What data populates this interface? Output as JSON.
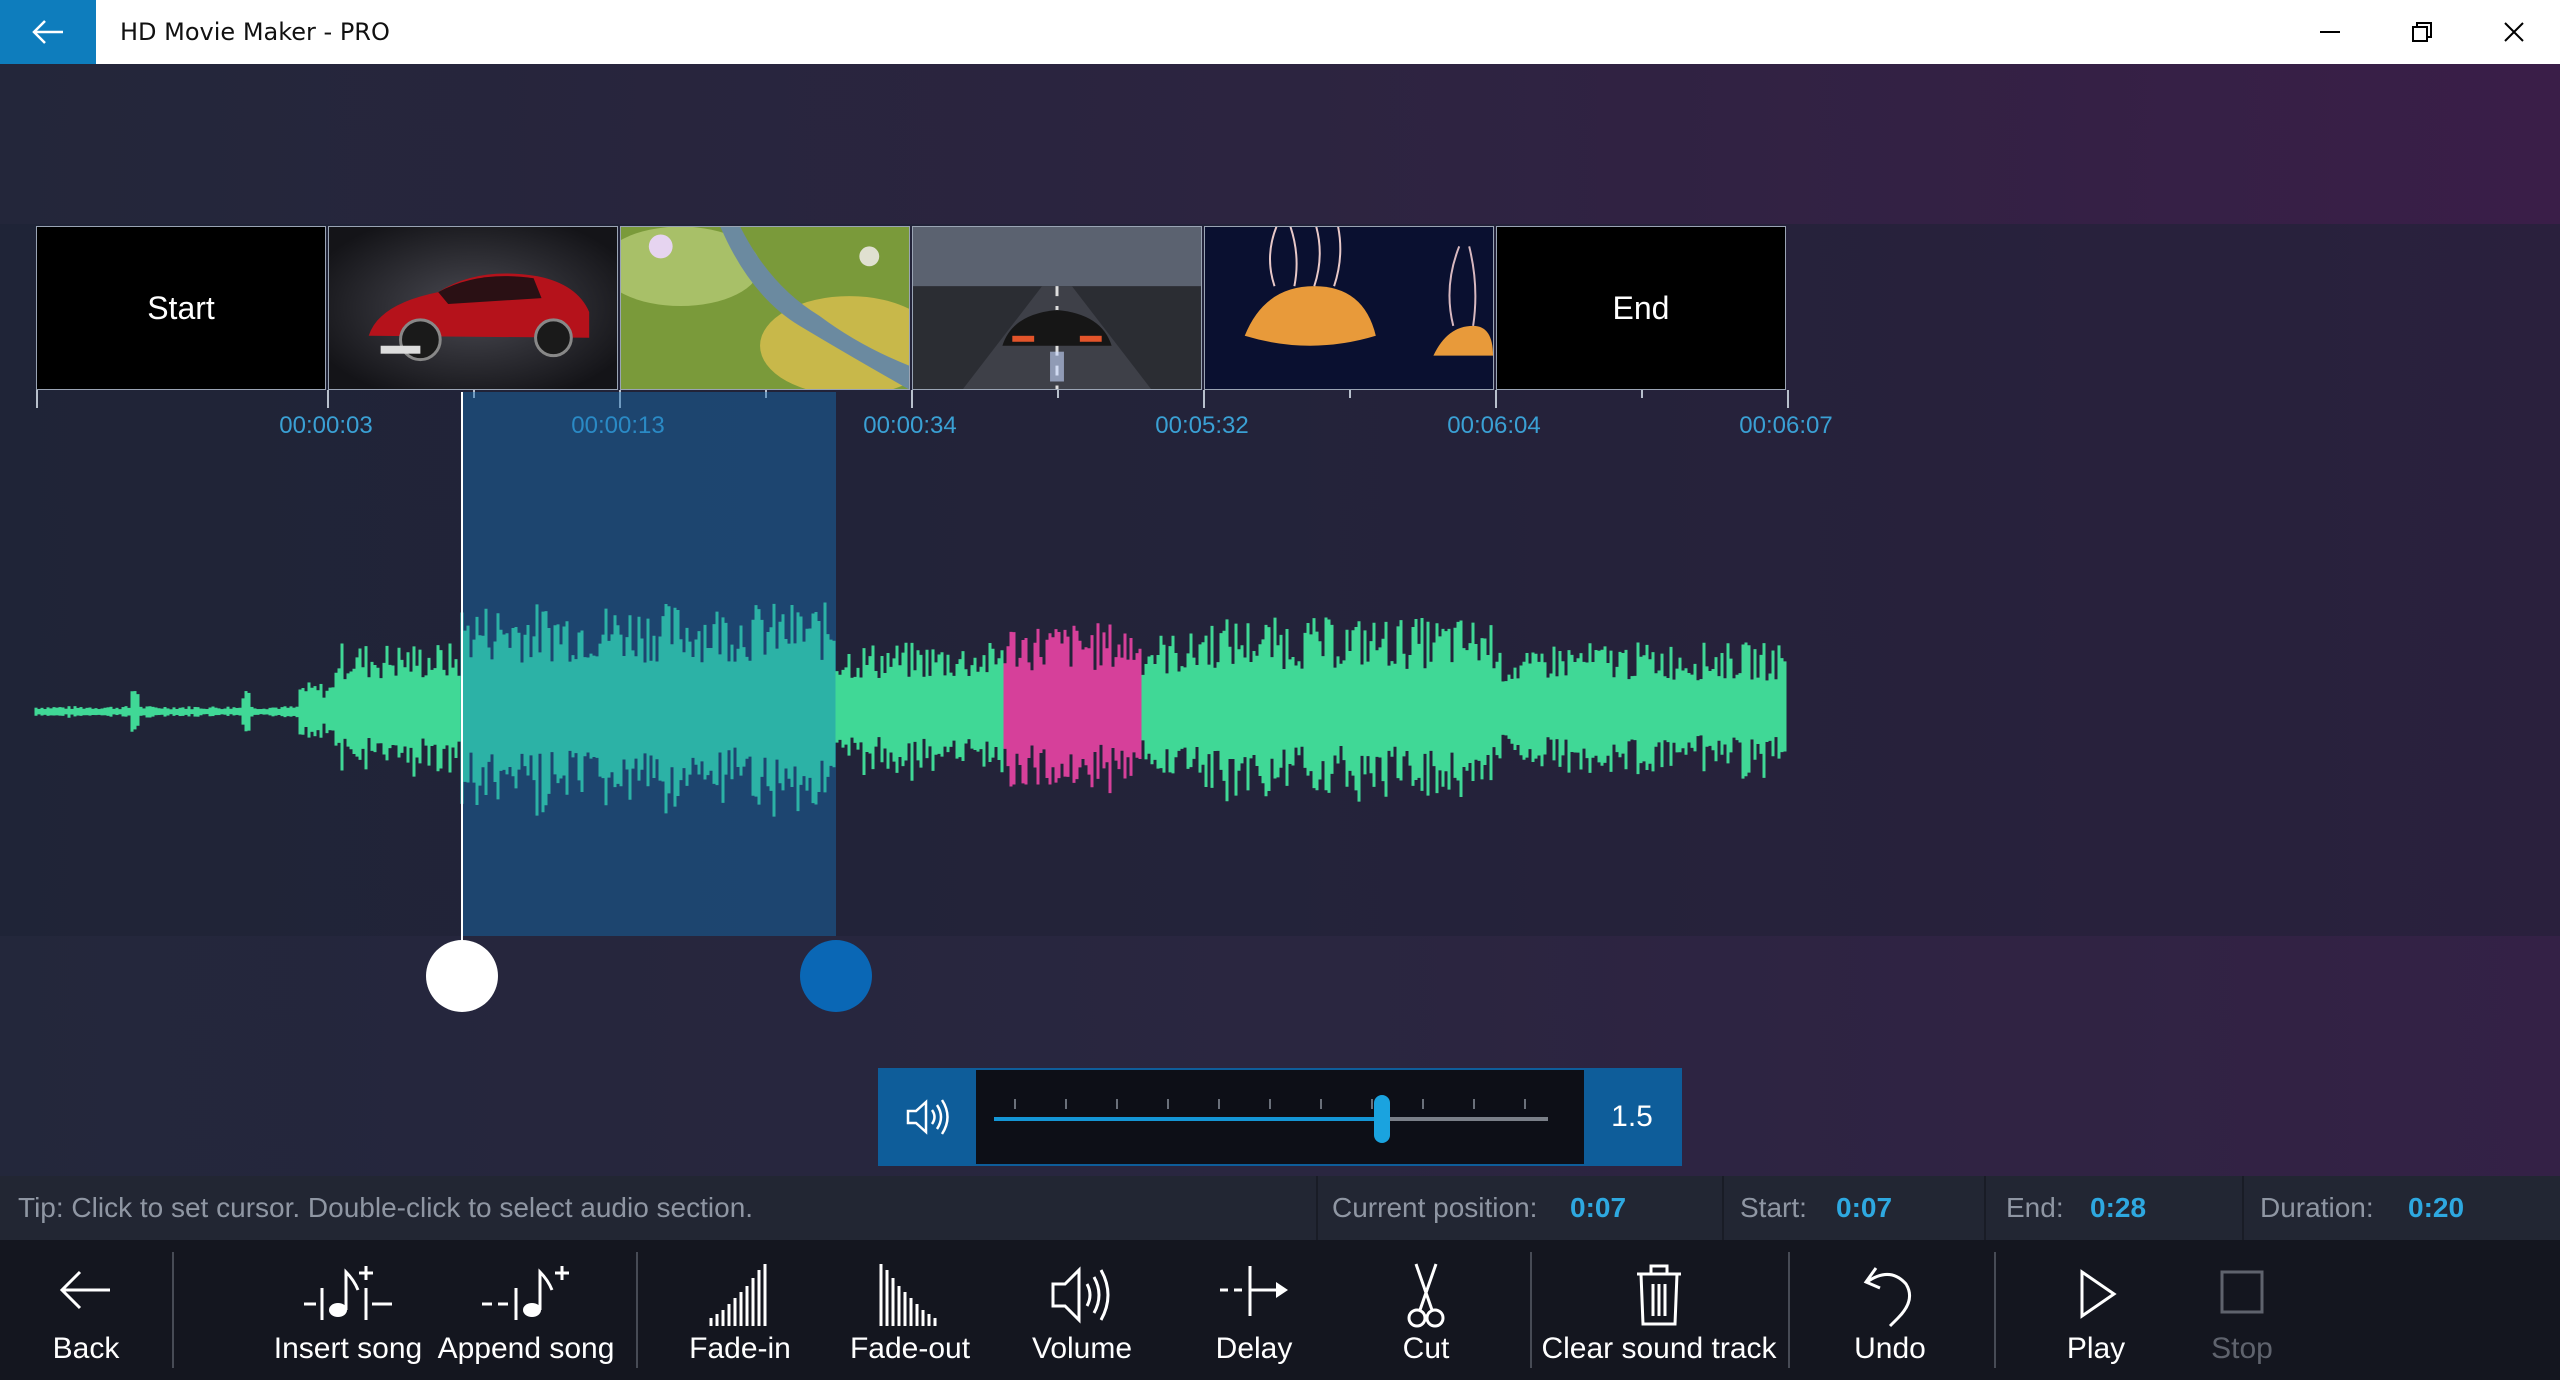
{
  "window": {
    "title": "HD Movie Maker - PRO",
    "back_icon": "arrow-left-icon",
    "controls": [
      "minimize-icon",
      "restore-icon",
      "close-icon"
    ]
  },
  "timeline": {
    "clips": [
      {
        "type": "label",
        "label": "Start"
      },
      {
        "type": "image",
        "subject": "red car"
      },
      {
        "type": "image",
        "subject": "garden path"
      },
      {
        "type": "image",
        "subject": "sports car on road"
      },
      {
        "type": "image",
        "subject": "jellyfish"
      },
      {
        "type": "label",
        "label": "End"
      }
    ],
    "time_labels": [
      "00:00:03",
      "00:00:13",
      "00:00:34",
      "00:05:32",
      "00:06:04",
      "00:06:07"
    ]
  },
  "volume": {
    "icon": "speaker-icon",
    "level_fraction": 0.7,
    "value": "1.5"
  },
  "status": {
    "tip": "Tip: Click to set cursor. Double-click to select audio section.",
    "current_position_label": "Current position:",
    "current_position_value": "0:07",
    "start_label": "Start:",
    "start_value": "0:07",
    "end_label": "End:",
    "end_value": "0:28",
    "duration_label": "Duration:",
    "duration_value": "0:20"
  },
  "toolbar": {
    "back": "Back",
    "insert_song": "Insert song",
    "append_song": "Append song",
    "fade_in": "Fade-in",
    "fade_out": "Fade-out",
    "volume": "Volume",
    "delay": "Delay",
    "cut": "Cut",
    "clear_sound_track": "Clear sound track",
    "undo": "Undo",
    "play": "Play",
    "stop": "Stop"
  },
  "colors": {
    "accent": "#0e7dbd",
    "waveform": "#40d896",
    "waveform_selected": "#2cb2a6",
    "waveform_highlight": "#d6409a",
    "time_label": "#3aa0d4"
  }
}
